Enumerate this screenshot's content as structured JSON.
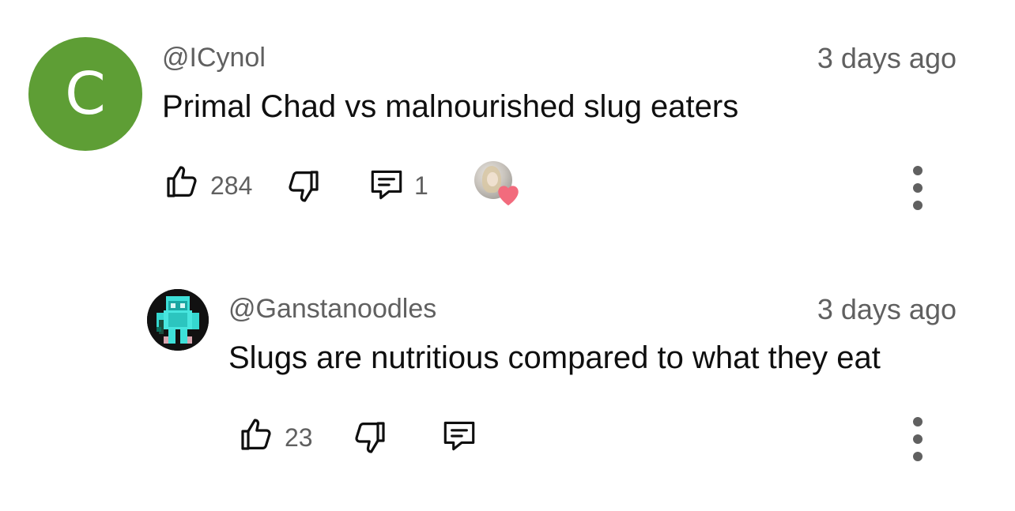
{
  "comments": [
    {
      "avatar_letter": "C",
      "avatar_color": "#5e9e35",
      "handle": "@ICynol",
      "time": "3 days ago",
      "text": "Primal Chad vs malnourished slug eaters",
      "likes": "284",
      "replies": "1",
      "creator_hearted": true
    },
    {
      "avatar_description_icon": "pixel-art-avatar",
      "handle": "@Ganstanoodles",
      "time": "3 days ago",
      "text": "Slugs are nutritious compared to what they eat",
      "likes": "23",
      "replies": ""
    }
  ],
  "icons": {
    "like": "thumbs-up-icon",
    "dislike": "thumbs-down-icon",
    "reply": "comment-icon",
    "more": "more-vertical-icon",
    "heart": "heart-icon"
  },
  "colors": {
    "text_primary": "#0f0f0f",
    "text_secondary": "#606060",
    "heart": "#f26b7d"
  }
}
